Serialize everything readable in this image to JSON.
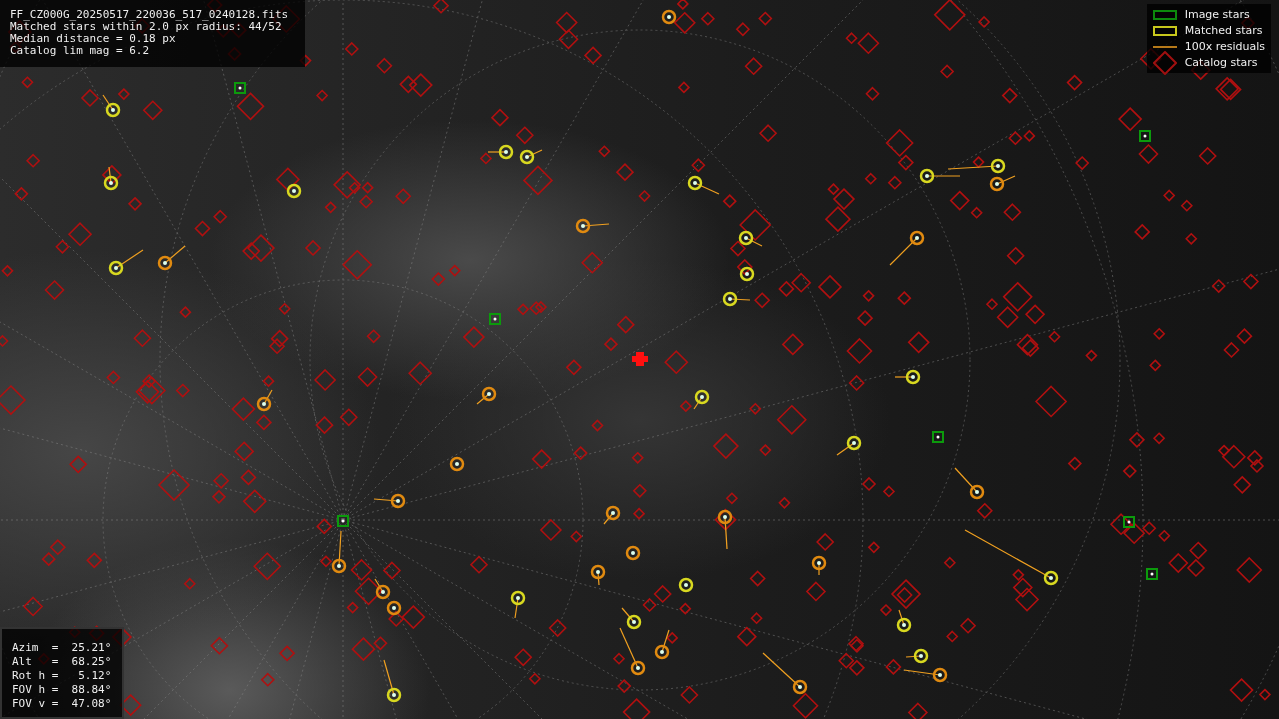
{
  "header": {
    "lines": [
      "FF_CZ000G_20250517_220036_517_0240128.fits",
      "Matched stars within 2.0 px radius: 44/52",
      "Median distance = 0.18 px",
      "Catalog lim mag = 6.2"
    ]
  },
  "legend": [
    {
      "kind": "image",
      "label": "Image stars"
    },
    {
      "kind": "matched",
      "label": "Matched stars"
    },
    {
      "kind": "residual",
      "label": "100x residuals"
    },
    {
      "kind": "catalog",
      "label": "Catalog stars"
    }
  ],
  "pointing": {
    "lines": [
      "Azim  =  25.21°",
      "Alt   =  68.25°",
      "Rot h =   5.12°",
      "FOV h =  88.84°",
      "FOV v =  47.08°"
    ]
  }
}
